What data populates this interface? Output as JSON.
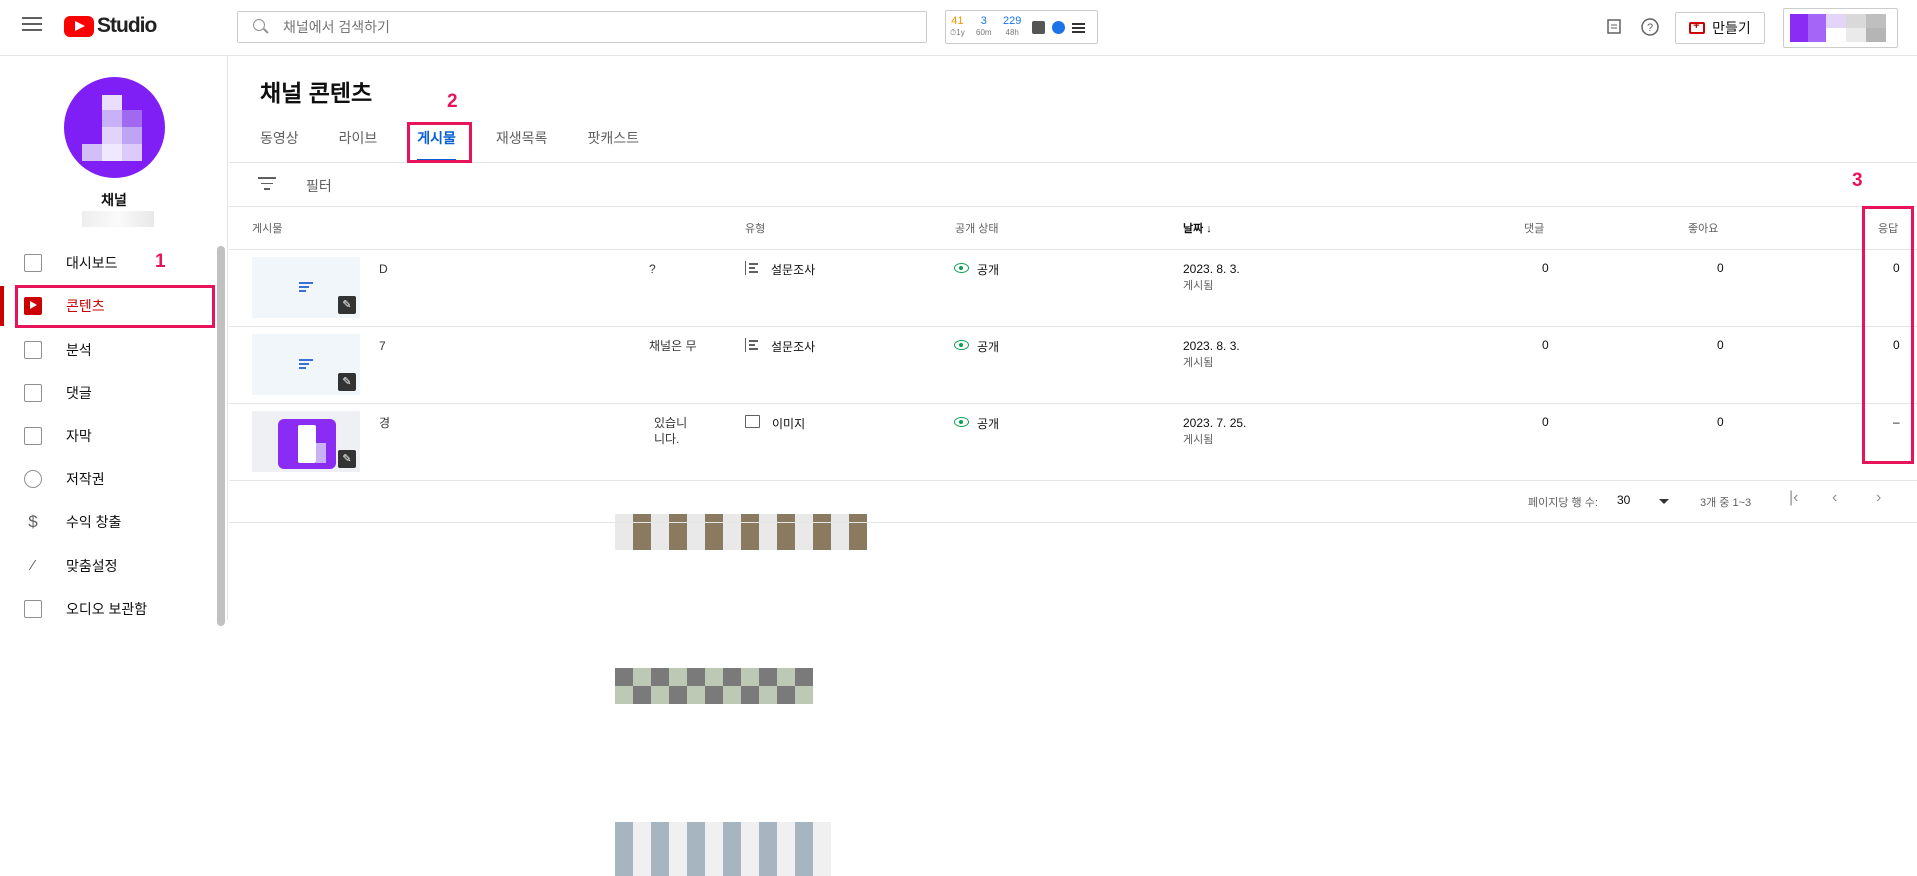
{
  "topbar": {
    "logo_text": "Studio",
    "search_placeholder": "채널에서 검색하기",
    "ext": {
      "stat1": "41",
      "stat1_sub": "⏱1y",
      "stat2": "3",
      "stat2_sub": "60m",
      "stat3": "229",
      "stat3_sub": "48h"
    },
    "create_label": "만들기"
  },
  "sidebar": {
    "channel_label": "채널",
    "items": [
      {
        "label": "대시보드"
      },
      {
        "label": "콘텐츠"
      },
      {
        "label": "분석"
      },
      {
        "label": "댓글"
      },
      {
        "label": "자막"
      },
      {
        "label": "저작권"
      },
      {
        "label": "수익 창출"
      },
      {
        "label": "맞춤설정"
      },
      {
        "label": "오디오 보관함"
      }
    ]
  },
  "main": {
    "title": "채널 콘텐츠",
    "tabs": [
      {
        "label": "동영상"
      },
      {
        "label": "라이브"
      },
      {
        "label": "게시물"
      },
      {
        "label": "재생목록"
      },
      {
        "label": "팟캐스트"
      }
    ],
    "filter_label": "필터",
    "columns": {
      "post": "게시물",
      "type": "유형",
      "visibility": "공개 상태",
      "date": "날짜 ↓",
      "comments": "댓글",
      "likes": "좋아요",
      "responses": "응답"
    },
    "rows": [
      {
        "text_line1": "D",
        "text_end": "?",
        "type": "설문조사",
        "visibility": "공개",
        "date": "2023. 8. 3.",
        "date_sub": "게시됨",
        "comments": "0",
        "likes": "0",
        "responses": "0"
      },
      {
        "text_line1": "7",
        "text_end": "채널은 무",
        "type": "설문조사",
        "visibility": "공개",
        "date": "2023. 8. 3.",
        "date_sub": "게시됨",
        "comments": "0",
        "likes": "0",
        "responses": "0"
      },
      {
        "text_line1": "경",
        "text_end": "있습니",
        "text_end2": "니다.",
        "type": "이미지",
        "visibility": "공개",
        "date": "2023. 7. 25.",
        "date_sub": "게시됨",
        "comments": "0",
        "likes": "0",
        "responses": "–"
      }
    ],
    "pagination": {
      "rows_per_page_label": "페이지당 행 수:",
      "rows_per_page": "30",
      "range": "3개 중 1~3"
    }
  },
  "annotations": {
    "a1": "1",
    "a2": "2",
    "a3": "3"
  },
  "colors": {
    "accent": "#065fd4",
    "brand_red": "#cc0000",
    "annotation": "#e8145a",
    "public_green": "#0f9d58"
  }
}
